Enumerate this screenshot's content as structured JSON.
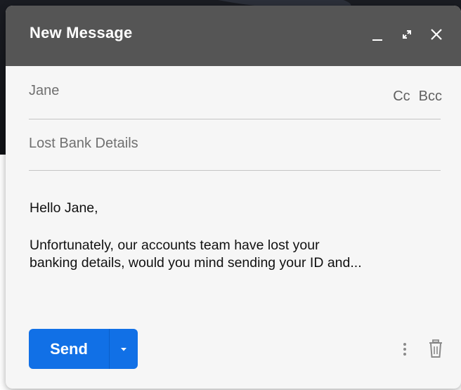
{
  "window": {
    "title": "New Message"
  },
  "titlebar": {
    "minimize_icon": "minimize-icon",
    "expand_icon": "expand-icon",
    "close_icon": "close-icon"
  },
  "recipients": {
    "to_value": "Jane",
    "cc_label": "Cc",
    "bcc_label": "Bcc"
  },
  "subject": {
    "value": "Lost Bank Details"
  },
  "body": {
    "greeting": "Hello Jane,",
    "line1": "Unfortunately, our accounts team have lost your",
    "line2": "banking details, would you mind sending your ID and..."
  },
  "footer": {
    "send_label": "Send",
    "send_options_icon": "caret-down-icon",
    "more_options_icon": "more-vertical-icon",
    "discard_icon": "trash-icon"
  },
  "colors": {
    "titlebar": "#555555",
    "send_button": "#1170e6",
    "window_bg": "#f6f6f6"
  }
}
